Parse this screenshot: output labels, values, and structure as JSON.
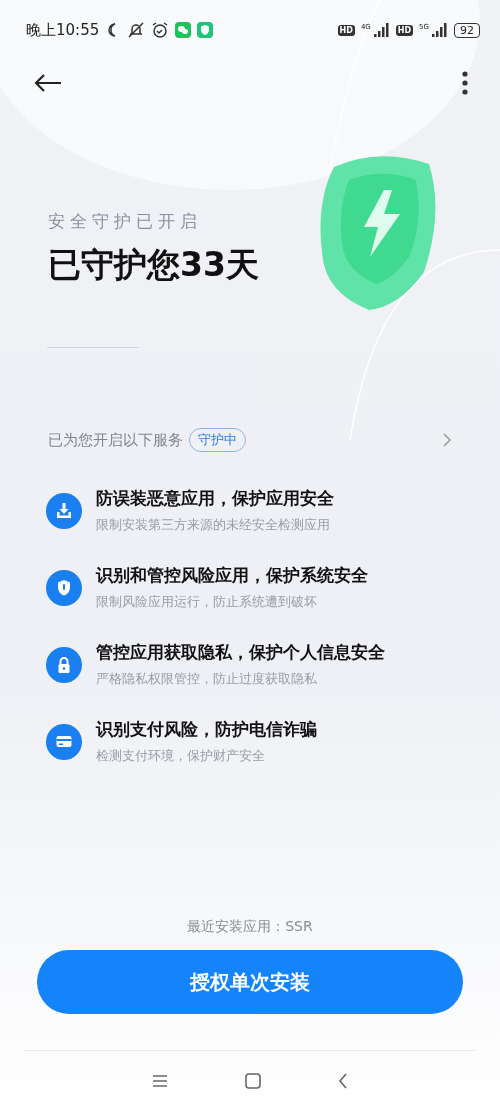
{
  "status_bar": {
    "time": "晚上10:55",
    "sim_1": {
      "badge": "HD",
      "network": "4G"
    },
    "sim_2": {
      "badge": "HD",
      "network": "5G"
    },
    "battery": "92"
  },
  "hero": {
    "subtitle": "安全守护已开启",
    "title": "已守护您33天"
  },
  "services": {
    "heading": "已为您开启以下服务",
    "badge": "守护中",
    "items": [
      {
        "kind": "download",
        "title": "防误装恶意应用，保护应用安全",
        "description": "限制安装第三方来源的未经安全检测应用"
      },
      {
        "kind": "shield",
        "title": "识别和管控风险应用，保护系统安全",
        "description": "限制风险应用运行，防止系统遭到破坏"
      },
      {
        "kind": "lock",
        "title": "管控应用获取隐私，保护个人信息安全",
        "description": "严格隐私权限管控，防止过度获取隐私"
      },
      {
        "kind": "card",
        "title": "识别支付风险，防护电信诈骗",
        "description": "检测支付环境，保护财产安全"
      }
    ]
  },
  "recent_app": "最近安装应用：SSR",
  "primary_button": "授权单次安装"
}
